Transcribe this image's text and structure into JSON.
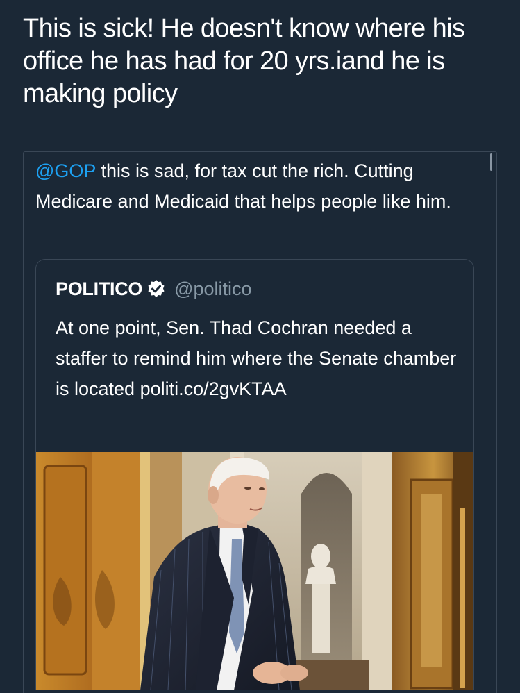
{
  "tweet": {
    "text": "This is sick! He doesn't know where his office he has had for 20 yrs.iand he is making policy"
  },
  "reply": {
    "mention": "@GOP",
    "text": " this is sad, for tax cut the rich. Cutting Medicare and Medicaid that helps people like him."
  },
  "quoted": {
    "name": "POLITICO",
    "handle": "@politico",
    "text": "At one point, Sen. Thad Cochran needed a staffer to remind him where the Senate chamber is located politi.co/2gvKTAA"
  },
  "colors": {
    "background": "#1b2836",
    "mention": "#1da1f2",
    "handle": "#8899a6",
    "border": "#3a4756"
  },
  "icons": {
    "verified": "verified-badge-icon"
  }
}
